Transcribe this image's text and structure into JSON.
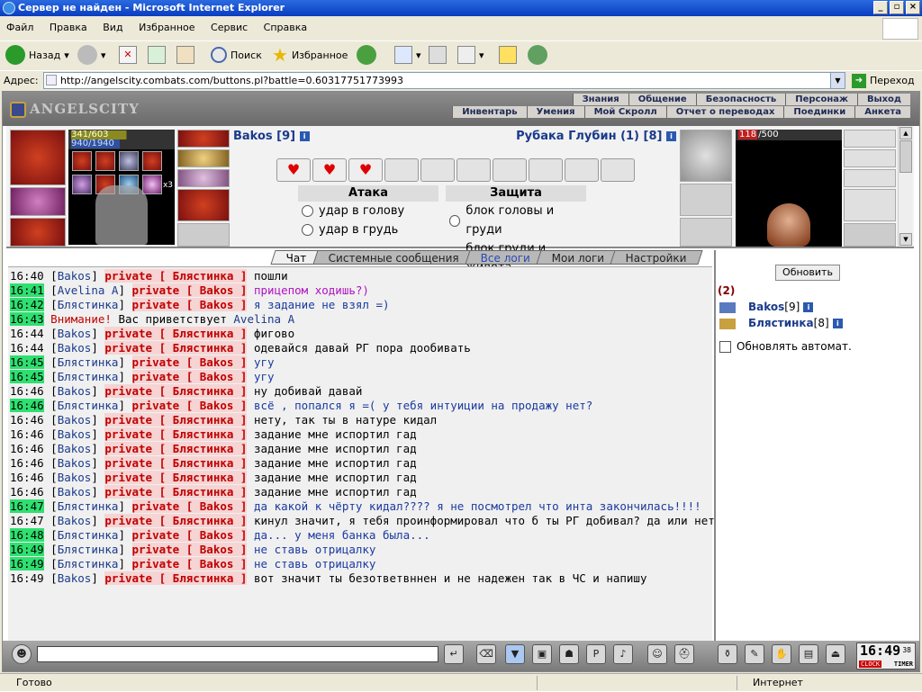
{
  "window": {
    "title": "Сервер не найден - Microsoft Internet Explorer"
  },
  "menu": [
    "Файл",
    "Правка",
    "Вид",
    "Избранное",
    "Сервис",
    "Справка"
  ],
  "toolbar": {
    "back": "Назад",
    "search": "Поиск",
    "favorites": "Избранное"
  },
  "address": {
    "label": "Адрес:",
    "url": "http://angelscity.combats.com/buttons.pl?battle=0.60317751773993",
    "go": "Переход"
  },
  "game": {
    "logo": "ANGELSCITY",
    "nav_top": [
      "Знания",
      "Общение",
      "Безопасность",
      "Персонаж",
      "Выход"
    ],
    "nav_bottom": [
      "Инвентарь",
      "Умения",
      "Мой Скролл",
      "Отчет о переводах",
      "Поединки",
      "Анкета"
    ]
  },
  "battle": {
    "player1": {
      "name": "Bakos [9]",
      "hp": "341/603",
      "mp": "940/1940",
      "stack": "x3"
    },
    "player2": {
      "name": "Рубака Глубин (1) [8]",
      "hp": "118",
      "hp_max": "/500"
    },
    "attack": {
      "title": "Атака",
      "options": [
        "удар в голову",
        "удар в грудь"
      ]
    },
    "defense": {
      "title": "Защита",
      "options": [
        "блок головы и груди",
        "блок груди и живота"
      ]
    }
  },
  "tabs": [
    {
      "label": "Чат"
    },
    {
      "label": "Системные сообщения"
    },
    {
      "label": "Все логи"
    },
    {
      "label": "Мои логи"
    },
    {
      "label": "Настройки"
    }
  ],
  "chat": [
    {
      "time": "16:40",
      "green": false,
      "from": "Bakos",
      "to": "Блястинка",
      "msg": "пошли",
      "style": "n"
    },
    {
      "time": "16:41",
      "green": true,
      "from": "Avelina A",
      "to": "Bakos",
      "msg": "прицепом ходишь?)",
      "style": "m"
    },
    {
      "time": "16:42",
      "green": true,
      "from": "Блястинка",
      "to": "Bakos",
      "msg": "я задание не взял =)",
      "style": "b"
    },
    {
      "time": "16:43",
      "green": true,
      "system": true,
      "warn": "Внимание!",
      "msg": "Вас приветствует",
      "who": "Avelina A"
    },
    {
      "time": "16:44",
      "green": false,
      "from": "Bakos",
      "to": "Блястинка",
      "msg": "фигово",
      "style": "n"
    },
    {
      "time": "16:44",
      "green": false,
      "from": "Bakos",
      "to": "Блястинка",
      "msg": "одевайся давай РГ пора дообивать",
      "style": "n"
    },
    {
      "time": "16:45",
      "green": true,
      "from": "Блястинка",
      "to": "Bakos",
      "msg": "угу",
      "style": "b"
    },
    {
      "time": "16:45",
      "green": true,
      "from": "Блястинка",
      "to": "Bakos",
      "msg": "угу",
      "style": "b"
    },
    {
      "time": "16:46",
      "green": false,
      "from": "Bakos",
      "to": "Блястинка",
      "msg": "ну добивай давай",
      "style": "n"
    },
    {
      "time": "16:46",
      "green": true,
      "from": "Блястинка",
      "to": "Bakos",
      "msg": "всё , попался я =( у тебя интуиции на продажу нет?",
      "style": "b"
    },
    {
      "time": "16:46",
      "green": false,
      "from": "Bakos",
      "to": "Блястинка",
      "msg": "нету, так ты в натуре кидал",
      "style": "n"
    },
    {
      "time": "16:46",
      "green": false,
      "from": "Bakos",
      "to": "Блястинка",
      "msg": "задание мне испортил гад",
      "style": "n"
    },
    {
      "time": "16:46",
      "green": false,
      "from": "Bakos",
      "to": "Блястинка",
      "msg": "задание мне испортил гад",
      "style": "n"
    },
    {
      "time": "16:46",
      "green": false,
      "from": "Bakos",
      "to": "Блястинка",
      "msg": "задание мне испортил гад",
      "style": "n"
    },
    {
      "time": "16:46",
      "green": false,
      "from": "Bakos",
      "to": "Блястинка",
      "msg": "задание мне испортил гад",
      "style": "n"
    },
    {
      "time": "16:46",
      "green": false,
      "from": "Bakos",
      "to": "Блястинка",
      "msg": "задание мне испортил гад",
      "style": "n"
    },
    {
      "time": "16:47",
      "green": true,
      "from": "Блястинка",
      "to": "Bakos",
      "msg": "да какой к чёрту кидал???? я не посмотрел что инта закончилась!!!!",
      "style": "b"
    },
    {
      "time": "16:47",
      "green": false,
      "from": "Bakos",
      "to": "Блястинка",
      "msg": "кинул значит, я тебя проинформировал что б ты РГ добивал? да или нет?",
      "style": "n"
    },
    {
      "time": "16:48",
      "green": true,
      "from": "Блястинка",
      "to": "Bakos",
      "msg": "да... у меня банка была...",
      "style": "b"
    },
    {
      "time": "16:49",
      "green": true,
      "from": "Блястинка",
      "to": "Bakos",
      "msg": "не ставь отрицалку",
      "style": "b"
    },
    {
      "time": "16:49",
      "green": true,
      "from": "Блястинка",
      "to": "Bakos",
      "msg": "не ставь отрицалку",
      "style": "b"
    },
    {
      "time": "16:49",
      "green": false,
      "from": "Bakos",
      "to": "Блястинка",
      "msg": "вот значит ты безответвннен и не надежен так в ЧС и напишу",
      "style": "n"
    }
  ],
  "side": {
    "refresh": "Обновить",
    "count": "(2)",
    "players": [
      {
        "name": "Bakos",
        "lvl": "[9]"
      },
      {
        "name": "Блястинка",
        "lvl": "[8]"
      }
    ],
    "auto": "Обновлять автомат."
  },
  "clock": {
    "time": "16:49",
    "sec": "38",
    "clock_label": "CLOCK",
    "timer_label": "TIMER"
  },
  "status": {
    "left": "Готово",
    "right": "Интернет"
  },
  "colors": {
    "green_time": "#2ee070",
    "private": "#c00000",
    "nick": "#1a3a8a"
  }
}
